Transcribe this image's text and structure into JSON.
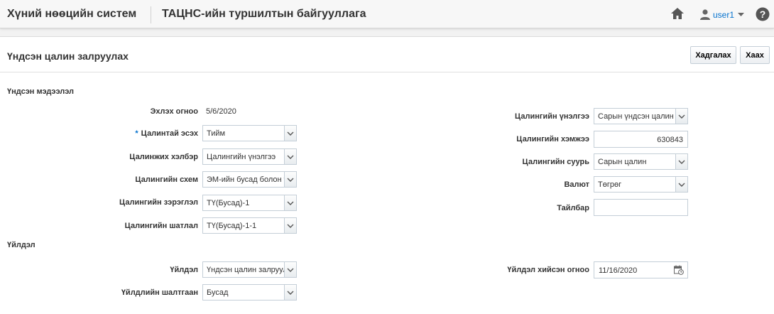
{
  "header": {
    "app_title": "Хүний нөөцийн систем",
    "org_title": "ТАЦНС-ийн туршилтын байгууллага",
    "home_icon": "home-icon",
    "user_icon": "user-icon",
    "user_name": "user1",
    "help_icon": "help-icon"
  },
  "page": {
    "title": "Үндсэн цалин залруулах",
    "save_label": "Хадгалах",
    "close_label": "Хаах"
  },
  "section_basic": {
    "title": "Үндсэн мэдээлэл",
    "start_date": {
      "label": "Эхлэх огноо",
      "value": "5/6/2020"
    },
    "paid": {
      "required_mark": "*",
      "label": "Цалинтай эсэх",
      "value": "Тийм"
    },
    "pay_form": {
      "label": "Цалинжих хэлбэр",
      "value": "Цалингийн үнэлгээ"
    },
    "pay_scheme": {
      "label": "Цалингийн схем",
      "value": "ЭМ-ийн бусад болон төрийн"
    },
    "pay_grade": {
      "label": "Цалингийн зэрэглэл",
      "value": "ТҮ(Бусад)-1"
    },
    "pay_step": {
      "label": "Цалингийн шатлал",
      "value": "ТҮ(Бусад)-1-1"
    },
    "pay_rating": {
      "label": "Цалингийн үнэлгээ",
      "value": "Сарын үндсэн цалин ("
    },
    "pay_amount": {
      "label": "Цалингийн хэмжээ",
      "value": "630843"
    },
    "pay_basis": {
      "label": "Цалингийн суурь",
      "value": "Сарын цалин"
    },
    "currency": {
      "label": "Валют",
      "value": "Төгрөг"
    },
    "note": {
      "label": "Тайлбар",
      "value": ""
    }
  },
  "section_action": {
    "title": "Үйлдэл",
    "action": {
      "label": "Үйлдэл",
      "value": "Үндсэн цалин залруулах"
    },
    "reason": {
      "label": "Үйлдлийн шалтгаан",
      "value": "Бусад"
    },
    "action_date": {
      "label": "Үйлдэл хийсэн огноо",
      "value": "11/16/2020",
      "icon": "calendar-icon"
    }
  },
  "colors": {
    "link": "#0572ce",
    "border": "#c4ced7",
    "text": "#333333"
  }
}
